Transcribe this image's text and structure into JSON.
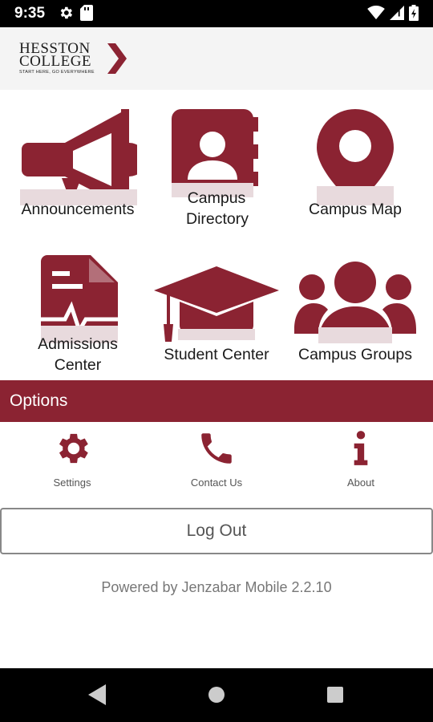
{
  "status_bar": {
    "time": "9:35",
    "left_icons": [
      "settings-icon",
      "sd-card-icon"
    ],
    "right_icons": [
      "wifi-icon",
      "signal-icon",
      "battery-icon"
    ]
  },
  "header": {
    "logo_line1": "HESSTON",
    "logo_line2": "COLLEGE",
    "logo_tagline": "START HERE, GO EVERYWHERE"
  },
  "colors": {
    "brand": "#8b2332",
    "icon_light": "#e8dadd"
  },
  "tiles": [
    {
      "label": "Announcements",
      "icon": "megaphone-icon"
    },
    {
      "label": "Campus Directory",
      "icon": "contact-book-icon"
    },
    {
      "label": "Campus Map",
      "icon": "map-pin-icon"
    },
    {
      "label": "Admissions Center",
      "icon": "document-icon"
    },
    {
      "label": "Student Center",
      "icon": "graduation-cap-icon"
    },
    {
      "label": "Campus Groups",
      "icon": "group-icon"
    }
  ],
  "options": {
    "title": "Options",
    "items": [
      {
        "label": "Settings",
        "icon": "gear-icon"
      },
      {
        "label": "Contact Us",
        "icon": "phone-icon"
      },
      {
        "label": "About",
        "icon": "info-icon"
      }
    ]
  },
  "logout_label": "Log Out",
  "powered_by": "Powered by Jenzabar Mobile 2.2.10",
  "nav": [
    "back-icon",
    "home-icon",
    "recents-icon"
  ]
}
